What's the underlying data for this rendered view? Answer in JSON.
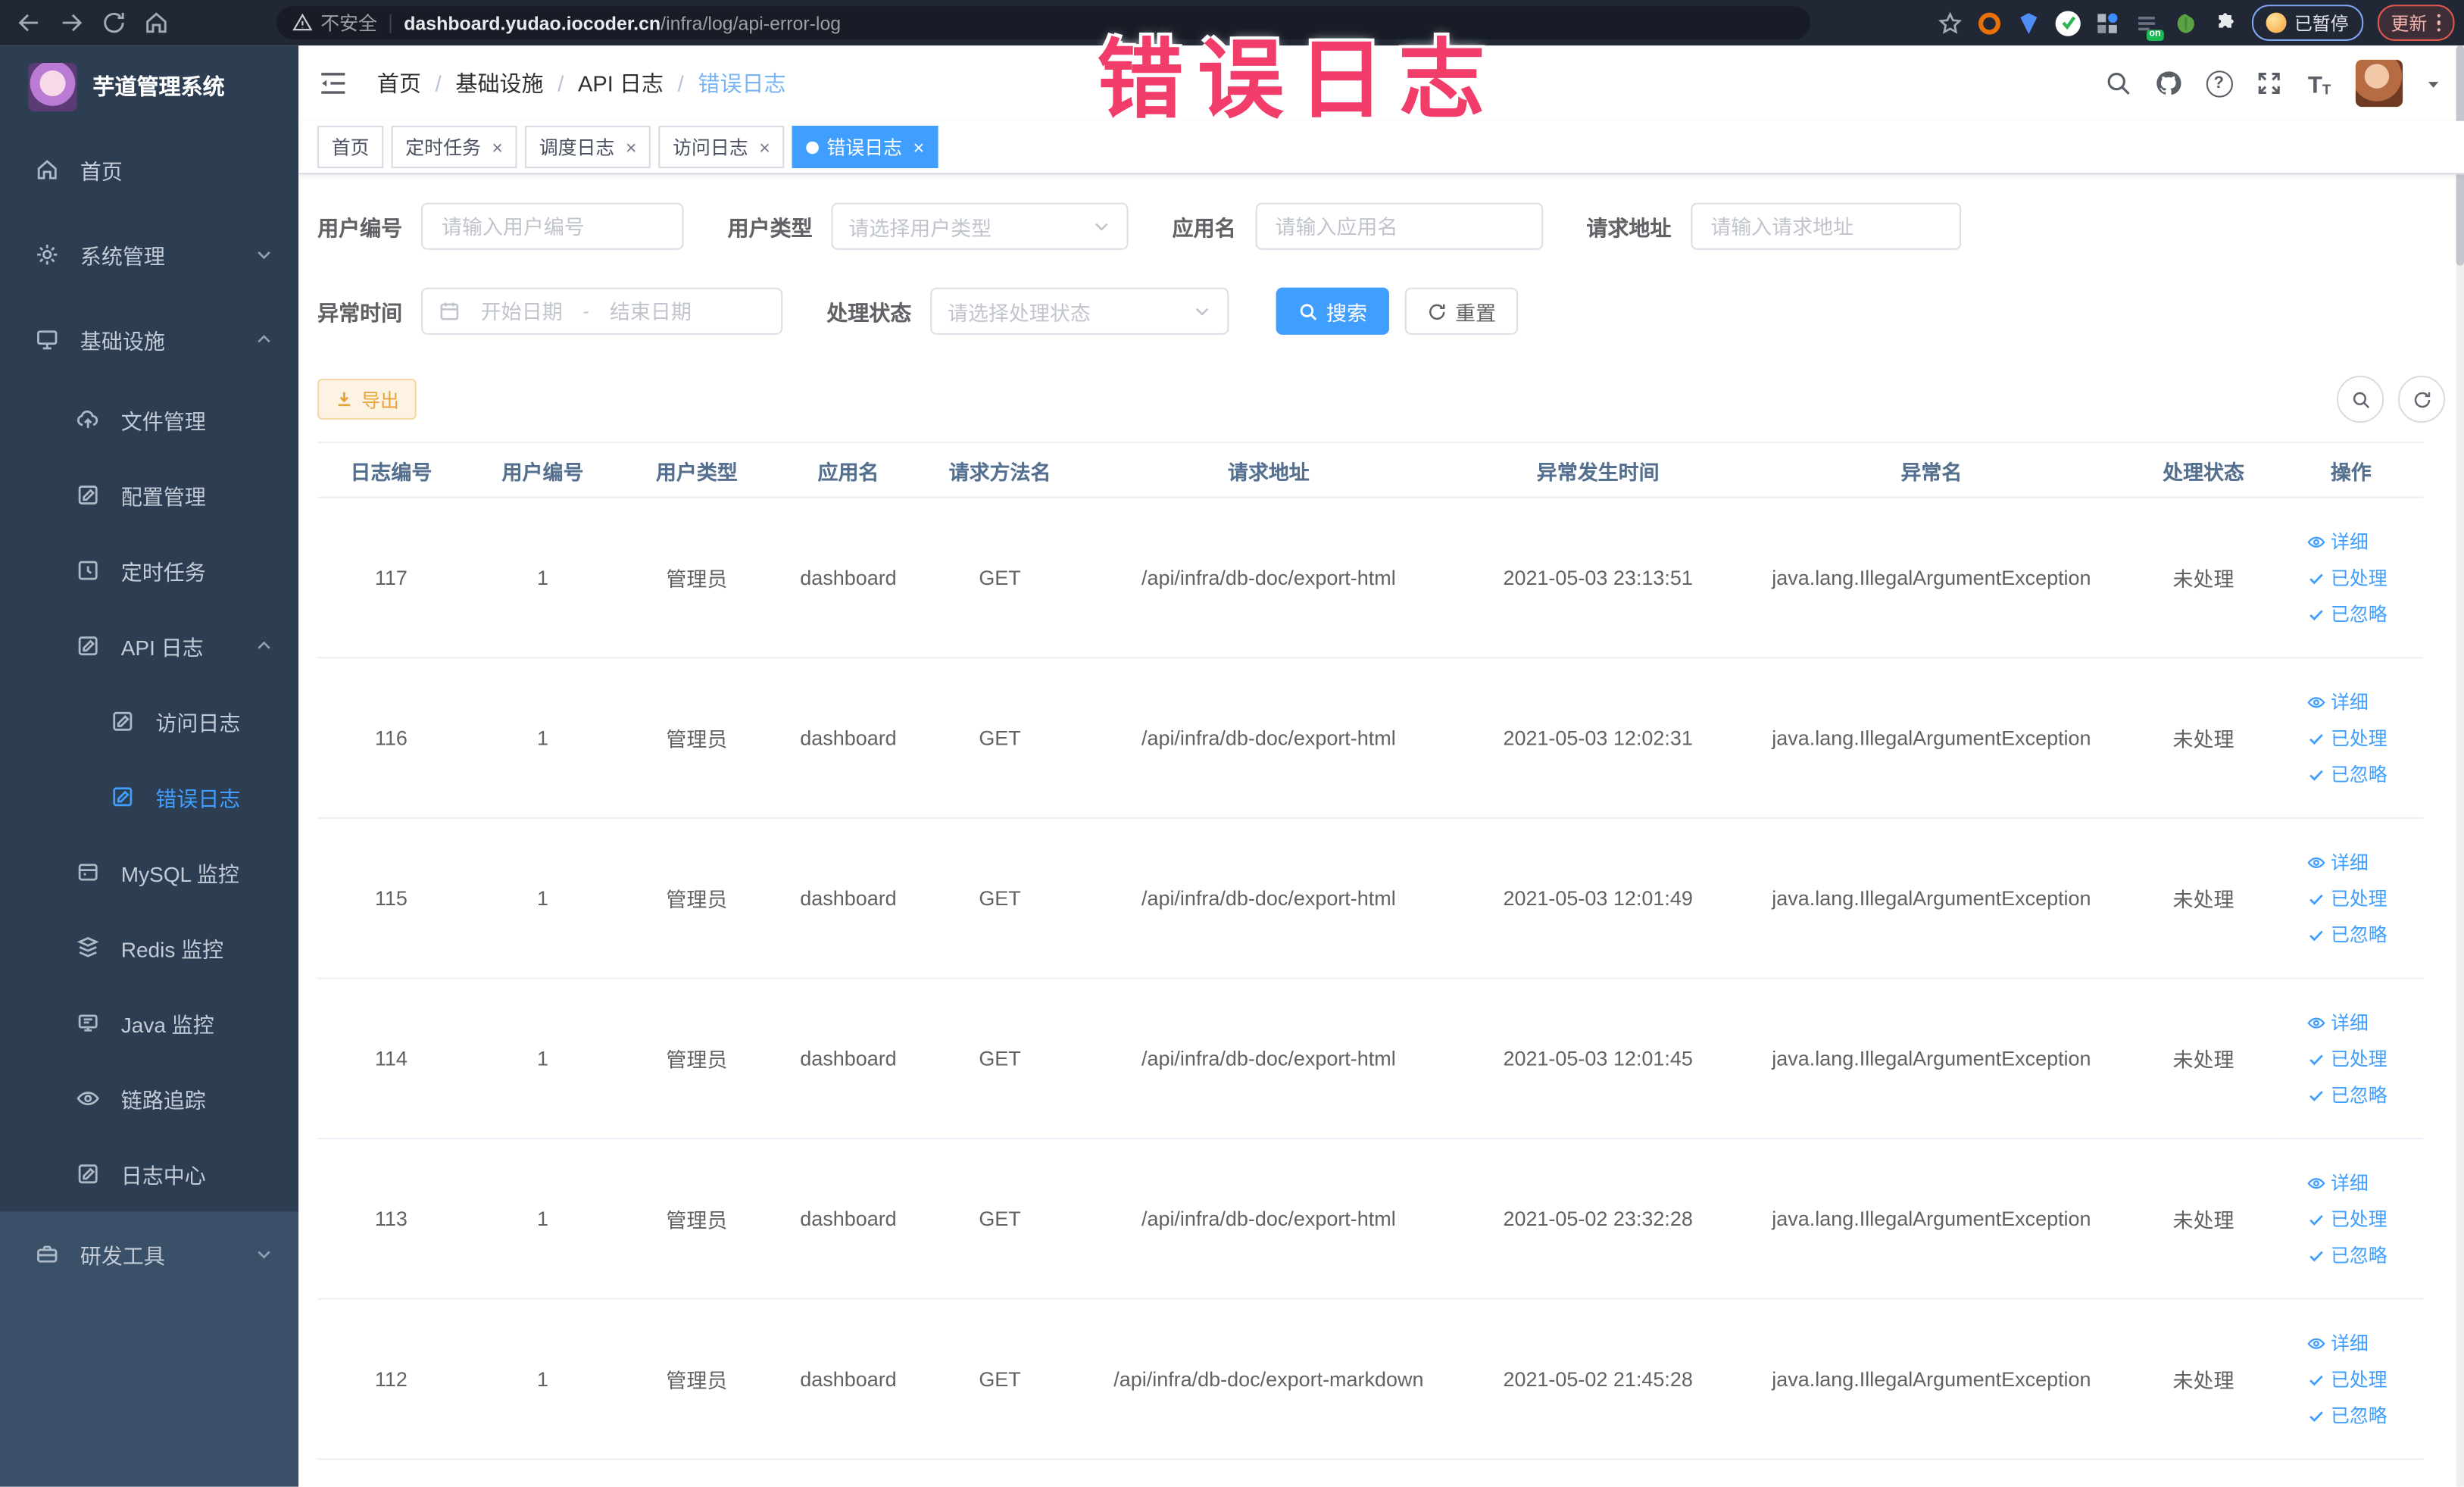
{
  "browser": {
    "security_label": "不安全",
    "url_domain": "dashboard.yudao.iocoder.cn",
    "url_path": "/infra/log/api-error-log",
    "paused_badge": "已暂停",
    "update_label": "更新"
  },
  "overlay": {
    "watermark": "错误日志"
  },
  "sidebar": {
    "title": "芋道管理系统",
    "items": [
      {
        "label": "首页"
      },
      {
        "label": "系统管理"
      },
      {
        "label": "基础设施"
      },
      {
        "label": "文件管理"
      },
      {
        "label": "配置管理"
      },
      {
        "label": "定时任务"
      },
      {
        "label": "API 日志"
      },
      {
        "label": "访问日志"
      },
      {
        "label": "错误日志"
      },
      {
        "label": "MySQL 监控"
      },
      {
        "label": "Redis 监控"
      },
      {
        "label": "Java 监控"
      },
      {
        "label": "链路追踪"
      },
      {
        "label": "日志中心"
      },
      {
        "label": "研发工具"
      }
    ]
  },
  "breadcrumb": {
    "items": [
      "首页",
      "基础设施",
      "API 日志",
      "错误日志"
    ]
  },
  "tabs": [
    {
      "label": "首页"
    },
    {
      "label": "定时任务"
    },
    {
      "label": "调度日志"
    },
    {
      "label": "访问日志"
    },
    {
      "label": "错误日志"
    }
  ],
  "filters": {
    "user_id_label": "用户编号",
    "user_id_placeholder": "请输入用户编号",
    "user_type_label": "用户类型",
    "user_type_placeholder": "请选择用户类型",
    "app_name_label": "应用名",
    "app_name_placeholder": "请输入应用名",
    "request_url_label": "请求地址",
    "request_url_placeholder": "请输入请求地址",
    "exception_time_label": "异常时间",
    "date_start_placeholder": "开始日期",
    "date_separator": "-",
    "date_end_placeholder": "结束日期",
    "process_status_label": "处理状态",
    "process_status_placeholder": "请选择处理状态",
    "search_label": "搜索",
    "reset_label": "重置"
  },
  "toolbar": {
    "export_label": "导出"
  },
  "table": {
    "headers": [
      "日志编号",
      "用户编号",
      "用户类型",
      "应用名",
      "请求方法名",
      "请求地址",
      "异常发生时间",
      "异常名",
      "处理状态",
      "操作"
    ],
    "actions": {
      "detail": "详细",
      "processed": "已处理",
      "ignored": "已忽略"
    },
    "rows": [
      {
        "id": "117",
        "user_id": "1",
        "user_type": "管理员",
        "app": "dashboard",
        "method": "GET",
        "url": "/api/infra/db-doc/export-html",
        "time": "2021-05-03 23:13:51",
        "exception": "java.lang.IllegalArgumentException",
        "status": "未处理"
      },
      {
        "id": "116",
        "user_id": "1",
        "user_type": "管理员",
        "app": "dashboard",
        "method": "GET",
        "url": "/api/infra/db-doc/export-html",
        "time": "2021-05-03 12:02:31",
        "exception": "java.lang.IllegalArgumentException",
        "status": "未处理"
      },
      {
        "id": "115",
        "user_id": "1",
        "user_type": "管理员",
        "app": "dashboard",
        "method": "GET",
        "url": "/api/infra/db-doc/export-html",
        "time": "2021-05-03 12:01:49",
        "exception": "java.lang.IllegalArgumentException",
        "status": "未处理"
      },
      {
        "id": "114",
        "user_id": "1",
        "user_type": "管理员",
        "app": "dashboard",
        "method": "GET",
        "url": "/api/infra/db-doc/export-html",
        "time": "2021-05-03 12:01:45",
        "exception": "java.lang.IllegalArgumentException",
        "status": "未处理"
      },
      {
        "id": "113",
        "user_id": "1",
        "user_type": "管理员",
        "app": "dashboard",
        "method": "GET",
        "url": "/api/infra/db-doc/export-html",
        "time": "2021-05-02 23:32:28",
        "exception": "java.lang.IllegalArgumentException",
        "status": "未处理"
      },
      {
        "id": "112",
        "user_id": "1",
        "user_type": "管理员",
        "app": "dashboard",
        "method": "GET",
        "url": "/api/infra/db-doc/export-markdown",
        "time": "2021-05-02 21:45:28",
        "exception": "java.lang.IllegalArgumentException",
        "status": "未处理"
      }
    ]
  },
  "colors": {
    "accent": "#409eff",
    "watermark_pink": "#f23d6b",
    "warning_orange": "#e6a23c",
    "sidebar_bg": "#2d3e53",
    "chrome_bg": "#212734"
  }
}
